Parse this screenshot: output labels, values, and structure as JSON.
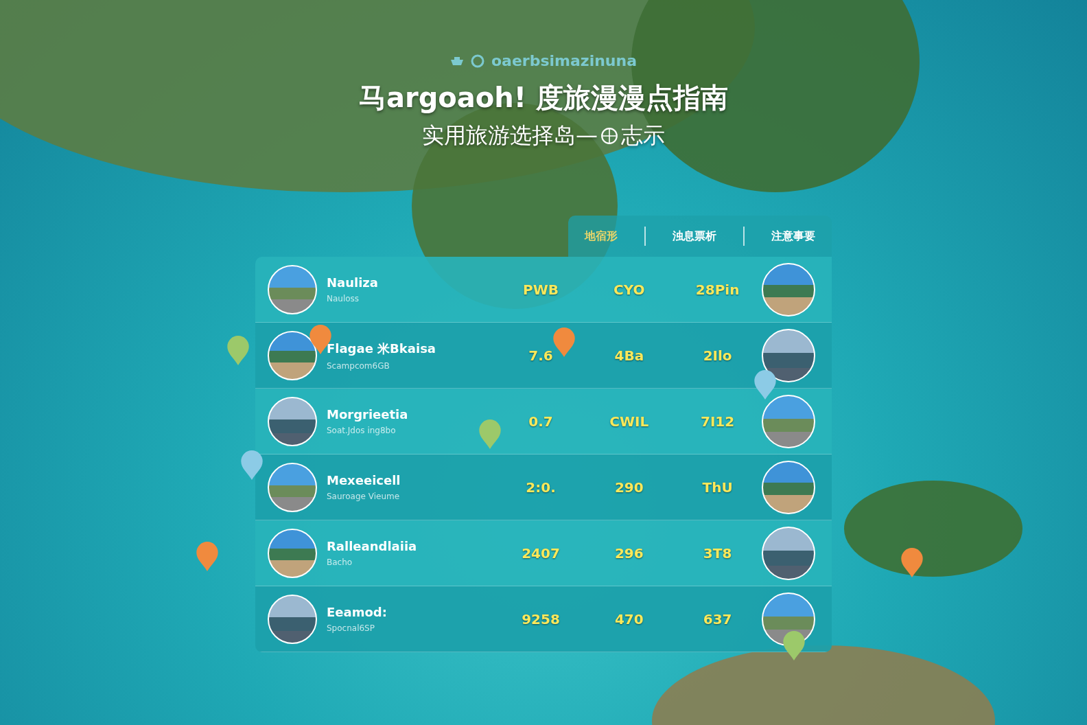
{
  "brand": {
    "name": "oaerbsimazinuna"
  },
  "title": "马argoaoh! 度旅漫漫点指南",
  "subtitle": {
    "before": "实用旅游选择岛—",
    "after": "志示"
  },
  "tabs": [
    {
      "label": "地宿形",
      "selected": true
    },
    {
      "label": "浊息票析",
      "selected": false
    },
    {
      "label": "注意事要",
      "selected": false
    }
  ],
  "rows": [
    {
      "name": "Nauliza",
      "detail": "Nauloss",
      "values": [
        "PWB",
        "CYO",
        "28Pin"
      ]
    },
    {
      "name": "Flagae 米Bkaisa",
      "detail": "Scampcom6GB",
      "values": [
        "7.6",
        "4Ba",
        "2Ilo"
      ]
    },
    {
      "name": "Morgrieetia",
      "detail": "Soat.Jdos ing8bo",
      "values": [
        "0.7",
        "CWIL",
        "7I12"
      ]
    },
    {
      "name": "Mexeeicell",
      "detail": "Sauroage Vieume",
      "values": [
        "2:0.",
        "290",
        "ThU"
      ]
    },
    {
      "name": "Ralleandlaiia",
      "detail": "Bacho",
      "values": [
        "2407",
        "296",
        "3T8"
      ]
    },
    {
      "name": "Eeamod:",
      "detail": "Spocnal6SP",
      "values": [
        "9258",
        "470",
        "637"
      ]
    }
  ],
  "pins": [
    {
      "color": "#f08a3e"
    },
    {
      "color": "#9cc96a"
    },
    {
      "color": "#f08a3e"
    },
    {
      "color": "#8ccbe6"
    },
    {
      "color": "#9cc96a"
    },
    {
      "color": "#8ccbe6"
    },
    {
      "color": "#f08a3e"
    },
    {
      "color": "#f08a3e"
    },
    {
      "color": "#9cc96a"
    }
  ]
}
